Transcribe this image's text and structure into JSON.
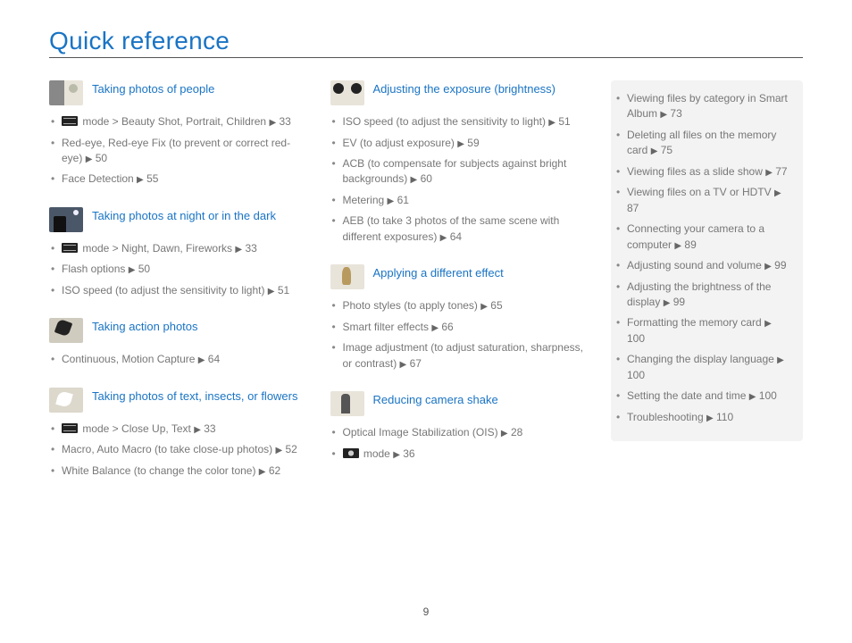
{
  "title": "Quick reference",
  "pageNumber": "9",
  "arrow": "▶",
  "col1": [
    {
      "title": "Taking photos of people",
      "thumbClass": "th-face",
      "items": [
        {
          "badge": "mode",
          "text": " mode > Beauty Shot, Portrait, Children ",
          "page": "33"
        },
        {
          "text": "Red-eye, Red-eye Fix (to prevent or correct red-eye) ",
          "page": "50"
        },
        {
          "text": "Face Detection ",
          "page": "55"
        }
      ]
    },
    {
      "title": "Taking photos at night or in the dark",
      "thumbClass": "th-night",
      "items": [
        {
          "badge": "mode",
          "text": " mode > Night, Dawn, Fireworks ",
          "page": "33"
        },
        {
          "text": "Flash options ",
          "page": "50"
        },
        {
          "text": "ISO speed (to adjust the sensitivity to light) ",
          "page": "51"
        }
      ]
    },
    {
      "title": "Taking action photos",
      "thumbClass": "th-action",
      "items": [
        {
          "text": "Continuous, Motion Capture ",
          "page": "64"
        }
      ]
    },
    {
      "title": "Taking photos of text, insects, or flowers",
      "thumbClass": "th-flower",
      "items": [
        {
          "badge": "mode",
          "text": " mode > Close Up, Text ",
          "page": "33"
        },
        {
          "text": "Macro, Auto Macro (to take close-up photos) ",
          "page": "52"
        },
        {
          "text": "White Balance (to change the color tone) ",
          "page": "62"
        }
      ]
    }
  ],
  "col2": [
    {
      "title": "Adjusting the exposure (brightness)",
      "thumbClass": "th-expo",
      "items": [
        {
          "text": "ISO speed (to adjust the sensitivity to light) ",
          "page": "51"
        },
        {
          "text": "EV (to adjust exposure) ",
          "page": "59"
        },
        {
          "text": "ACB (to compensate for subjects against bright backgrounds) ",
          "page": "60"
        },
        {
          "text": "Metering ",
          "page": "61"
        },
        {
          "text": "AEB (to take 3 photos of the same scene with different exposures) ",
          "page": "64"
        }
      ]
    },
    {
      "title": "Applying a different effect",
      "thumbClass": "th-effect",
      "items": [
        {
          "text": "Photo styles (to apply tones) ",
          "page": "65"
        },
        {
          "text": "Smart filter effects ",
          "page": "66"
        },
        {
          "text": "Image adjustment (to adjust saturation, sharpness, or contrast) ",
          "page": "67"
        }
      ]
    },
    {
      "title": "Reducing camera shake",
      "thumbClass": "th-shake",
      "items": [
        {
          "text": "Optical Image Stabilization (OIS) ",
          "page": "28"
        },
        {
          "badge": "dual",
          "text": " mode ",
          "page": "36"
        }
      ]
    }
  ],
  "side": [
    {
      "text": "Viewing files by category in Smart Album ",
      "page": "73"
    },
    {
      "text": "Deleting all files on the memory card ",
      "page": "75"
    },
    {
      "text": "Viewing files as a slide show ",
      "page": "77"
    },
    {
      "text": "Viewing files on a TV or HDTV ",
      "page": "87"
    },
    {
      "text": "Connecting your camera to a computer ",
      "page": "89"
    },
    {
      "text": "Adjusting sound and volume ",
      "page": "99"
    },
    {
      "text": "Adjusting the brightness of the display ",
      "page": "99"
    },
    {
      "text": "Formatting the memory card ",
      "page": "100"
    },
    {
      "text": "Changing the display language ",
      "page": "100"
    },
    {
      "text": "Setting the date and time ",
      "page": "100"
    },
    {
      "text": "Troubleshooting ",
      "page": "110"
    }
  ]
}
